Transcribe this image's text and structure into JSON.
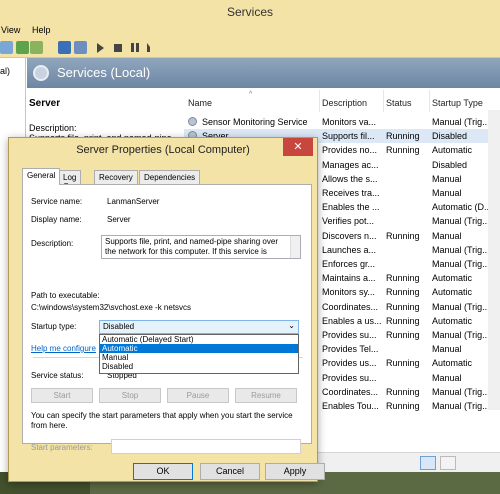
{
  "window": {
    "title": "Services"
  },
  "menu": {
    "items": [
      "View",
      "Help"
    ]
  },
  "tree": {
    "partial_label": "al)"
  },
  "banner": {
    "title": "Services (Local)"
  },
  "desc_pane": {
    "service_name": "Server",
    "description_label": "Description:",
    "description_partial": "Supports file, print, and named-pipe"
  },
  "list": {
    "headers": {
      "name": "Name",
      "description": "Description",
      "status": "Status",
      "startup": "Startup Type"
    },
    "rows": [
      {
        "name": "Sensor Monitoring Service",
        "description": "Monitors va...",
        "status": "",
        "startup": "Manual (Trig..."
      },
      {
        "name": "Server",
        "description": "Supports fil...",
        "status": "Running",
        "startup": "Disabled"
      },
      {
        "name": "",
        "description": "Provides no...",
        "status": "Running",
        "startup": "Automatic"
      },
      {
        "name": "",
        "description": "Manages ac...",
        "status": "",
        "startup": "Disabled"
      },
      {
        "name": "",
        "description": "Allows the s...",
        "status": "",
        "startup": "Manual"
      },
      {
        "name": "",
        "description": "Receives tra...",
        "status": "",
        "startup": "Manual"
      },
      {
        "name": "",
        "description": "Enables the ...",
        "status": "",
        "startup": "Automatic (D..."
      },
      {
        "name": "",
        "description": "Verifies pot...",
        "status": "",
        "startup": "Manual (Trig..."
      },
      {
        "name": "",
        "description": "Discovers n...",
        "status": "Running",
        "startup": "Manual"
      },
      {
        "name": "",
        "description": "Launches a...",
        "status": "",
        "startup": "Manual (Trig..."
      },
      {
        "name": "",
        "description": "Enforces gr...",
        "status": "",
        "startup": "Manual (Trig..."
      },
      {
        "name": "",
        "description": "Maintains a...",
        "status": "Running",
        "startup": "Automatic"
      },
      {
        "name": "",
        "description": "Monitors sy...",
        "status": "Running",
        "startup": "Automatic"
      },
      {
        "name": "",
        "description": "Coordinates...",
        "status": "Running",
        "startup": "Manual (Trig..."
      },
      {
        "name": "",
        "description": "Enables a us...",
        "status": "Running",
        "startup": "Automatic"
      },
      {
        "name": "",
        "description": "Provides su...",
        "status": "Running",
        "startup": "Manual (Trig..."
      },
      {
        "name": "",
        "description": "Provides Tel...",
        "status": "",
        "startup": "Manual"
      },
      {
        "name": "",
        "description": "Provides us...",
        "status": "Running",
        "startup": "Automatic"
      },
      {
        "name": "",
        "description": "Provides su...",
        "status": "",
        "startup": "Manual"
      },
      {
        "name": "",
        "description": "Coordinates...",
        "status": "Running",
        "startup": "Manual (Trig..."
      },
      {
        "name": "",
        "description": "Enables Tou...",
        "status": "Running",
        "startup": "Manual (Trig..."
      }
    ]
  },
  "dialog": {
    "title": "Server Properties (Local Computer)",
    "close": "✕",
    "tabs": [
      "General",
      "Log On",
      "Recovery",
      "Dependencies"
    ],
    "service_name_label": "Service name:",
    "service_name_value": "LanmanServer",
    "display_name_label": "Display name:",
    "display_name_value": "Server",
    "description_label": "Description:",
    "description_value": "Supports file, print, and named-pipe sharing over the network for this computer. If this service is stopped,",
    "path_label": "Path to executable:",
    "path_value": "C:\\windows\\system32\\svchost.exe -k netsvcs",
    "startup_type_label": "Startup type:",
    "startup_type_value": "Disabled",
    "startup_options": [
      "Automatic (Delayed Start)",
      "Automatic",
      "Manual",
      "Disabled"
    ],
    "help_link": "Help me configure",
    "service_status_label": "Service status:",
    "service_status_value": "Stopped",
    "buttons": {
      "start": "Start",
      "stop": "Stop",
      "pause": "Pause",
      "resume": "Resume"
    },
    "params_note": "You can specify the start parameters that apply when you start the service from here.",
    "start_params_label": "Start parameters:",
    "start_params_value": "",
    "ok": "OK",
    "cancel": "Cancel",
    "apply": "Apply"
  }
}
